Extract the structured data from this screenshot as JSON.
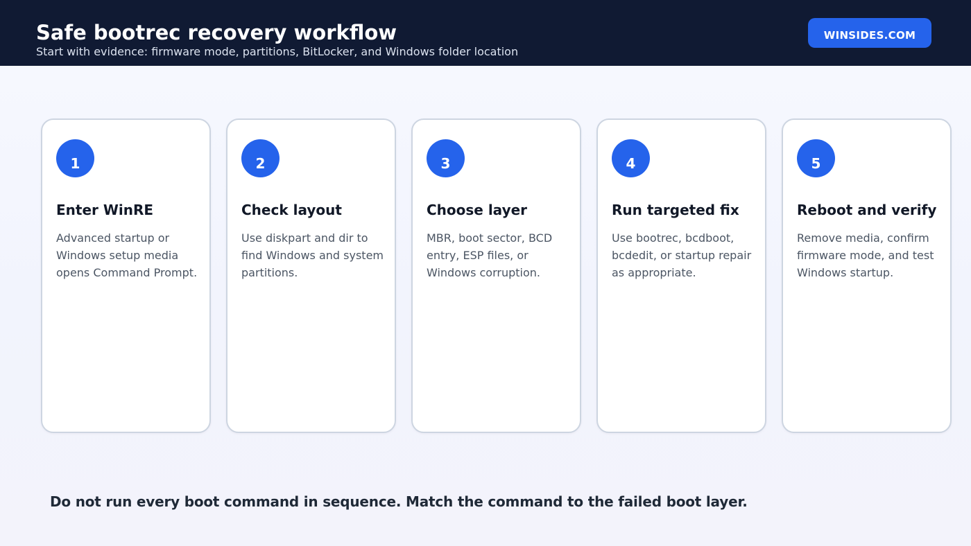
{
  "header": {
    "title": "Safe bootrec recovery workflow",
    "subtitle": "Start with evidence: firmware mode, partitions, BitLocker, and Windows folder location",
    "brand": "WINSIDES.COM"
  },
  "steps": [
    {
      "number": "1",
      "title": "Enter WinRE",
      "text": "Advanced startup or Windows setup media opens Command Prompt."
    },
    {
      "number": "2",
      "title": "Check layout",
      "text": "Use diskpart and dir to find Windows and system partitions."
    },
    {
      "number": "3",
      "title": "Choose layer",
      "text": "MBR, boot sector, BCD entry, ESP files, or Windows corruption."
    },
    {
      "number": "4",
      "title": "Run targeted fix",
      "text": "Use bootrec, bcdboot, bcdedit, or startup repair as appropriate."
    },
    {
      "number": "5",
      "title": "Reboot and verify",
      "text": "Remove media, confirm firmware mode, and test Windows startup."
    }
  ],
  "footer": {
    "note": "Do not run every boot command in sequence. Match the command to the failed boot layer."
  },
  "colors": {
    "header_bg": "#101a33",
    "accent": "#2563eb",
    "card_border": "#cdd5e1"
  }
}
